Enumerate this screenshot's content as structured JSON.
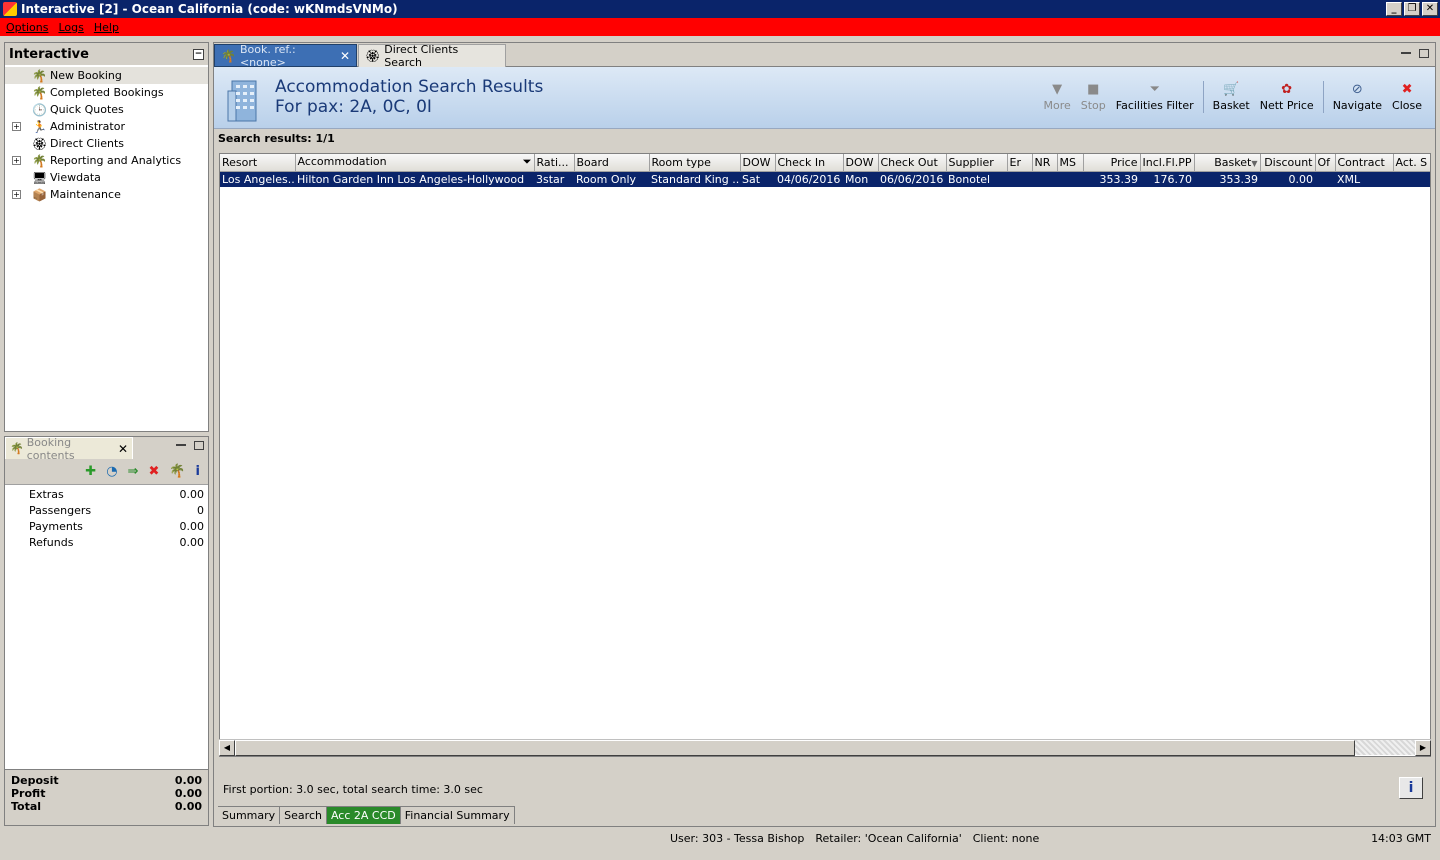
{
  "window": {
    "title": "Interactive [2] - Ocean California (code: wKNmdsVNMo)",
    "buttons": {
      "minimize": "_",
      "restore": "❐",
      "close": "✕"
    }
  },
  "menu": [
    "Options",
    "Logs",
    "Help"
  ],
  "nav": {
    "title": "Interactive",
    "items": [
      {
        "label": "New Booking",
        "icon": "palm-tree-icon",
        "expandable": false,
        "selected": true
      },
      {
        "label": "Completed Bookings",
        "icon": "palm-tree-icon",
        "expandable": false
      },
      {
        "label": "Quick Quotes",
        "icon": "clock-icon",
        "expandable": false
      },
      {
        "label": "Administrator",
        "icon": "person-icon",
        "expandable": true
      },
      {
        "label": "Direct Clients",
        "icon": "client-icon",
        "expandable": false
      },
      {
        "label": "Reporting and Analytics",
        "icon": "palm-tree-icon",
        "expandable": true
      },
      {
        "label": "Viewdata",
        "icon": "monitor-icon",
        "expandable": false
      },
      {
        "label": "Maintenance",
        "icon": "box-icon",
        "expandable": true
      }
    ]
  },
  "booking": {
    "tab_label": "Booking contents",
    "rows": [
      {
        "label": "Extras",
        "value": "0.00"
      },
      {
        "label": "Passengers",
        "value": "0"
      },
      {
        "label": "Payments",
        "value": "0.00"
      },
      {
        "label": "Refunds",
        "value": "0.00"
      }
    ],
    "footer": [
      {
        "label": "Deposit",
        "value": "0.00"
      },
      {
        "label": "Profit",
        "value": "0.00"
      },
      {
        "label": "Total",
        "value": "0.00"
      }
    ]
  },
  "tabs": [
    {
      "label": "Book. ref.: <none>",
      "active": true
    },
    {
      "label": "Direct Clients Search",
      "active": false
    }
  ],
  "header": {
    "title": "Accommodation Search Results",
    "subtitle": "For pax: 2A, 0C, 0I"
  },
  "toolbar": [
    {
      "label": "More",
      "icon": "triangle-down-icon",
      "disabled": true
    },
    {
      "label": "Stop",
      "icon": "stop-icon",
      "disabled": true
    },
    {
      "label": "Facilities Filter",
      "icon": "funnel-icon",
      "disabled": false
    },
    {
      "label": "Basket",
      "icon": "basket-icon",
      "disabled": false
    },
    {
      "label": "Nett Price",
      "icon": "price-icon",
      "disabled": false
    },
    {
      "label": "Navigate",
      "icon": "navigate-icon",
      "disabled": false
    },
    {
      "label": "Close",
      "icon": "close-icon",
      "disabled": false
    }
  ],
  "results": {
    "label": "Search results: 1/1",
    "columns": [
      "Resort",
      "Accommodation",
      "Rati...",
      "Board",
      "Room type",
      "DOW",
      "Check In",
      "DOW",
      "Check Out",
      "Supplier",
      "Er",
      "NR",
      "MS",
      "Price",
      "Incl.Fl.PP",
      "Basket",
      "Discount",
      "Of",
      "Contract",
      "Act. S"
    ],
    "rows": [
      [
        "Los Angeles...",
        "Hilton Garden Inn Los Angeles-Hollywood",
        "3star",
        "Room Only",
        "Standard King ...",
        "Sat",
        "04/06/2016",
        "Mon",
        "06/06/2016",
        "Bonotel",
        "",
        "",
        "",
        "353.39",
        "176.70",
        "353.39",
        "0.00",
        "",
        "XML",
        ""
      ]
    ]
  },
  "timing": "First portion: 3.0 sec, total search time: 3.0 sec",
  "bottom_tabs": [
    {
      "label": "Summary",
      "active": false
    },
    {
      "label": "Search",
      "active": false
    },
    {
      "label": "Acc 2A CCD",
      "active": true
    },
    {
      "label": "Financial Summary",
      "active": false
    }
  ],
  "status": {
    "user": "User: 303 - Tessa Bishop",
    "retailer": "Retailer: 'Ocean California'",
    "client": "Client: none",
    "time": "14:03 GMT"
  },
  "colors": {
    "menu_bg": "#ff0000",
    "title_bg": "#0a246a",
    "selected_row": "#0a246a",
    "active_bottom_tab": "#2a8a2a"
  }
}
